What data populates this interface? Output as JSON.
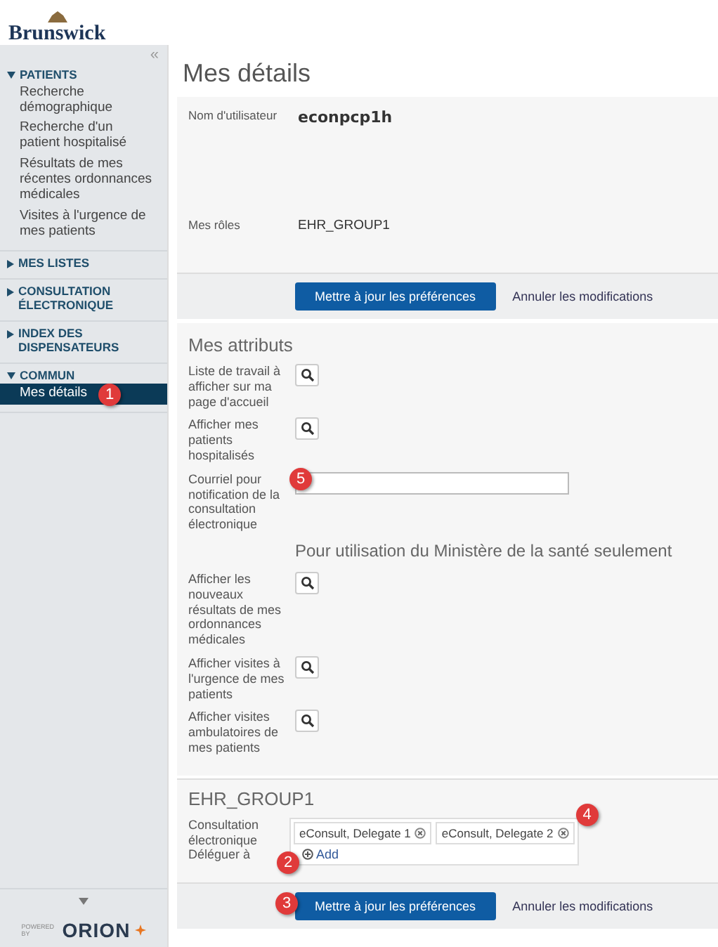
{
  "logo": {
    "name": "Brunswick"
  },
  "sidebar": {
    "collapse": "«",
    "sections": [
      {
        "label": "PATIENTS",
        "expanded": true,
        "items": [
          {
            "label": "Recherche démographique",
            "selected": false
          },
          {
            "label": "Recherche d'un patient hospitalisé",
            "selected": false
          },
          {
            "label": "Résultats de mes récentes ordonnances médicales",
            "selected": false
          },
          {
            "label": "Visites à l'urgence de mes patients",
            "selected": false
          }
        ]
      },
      {
        "label": "MES LISTES",
        "expanded": false
      },
      {
        "label": "CONSULTATION ÉLECTRONIQUE",
        "expanded": false
      },
      {
        "label": "INDEX DES DISPENSATEURS",
        "expanded": false
      },
      {
        "label": "COMMUN",
        "expanded": true,
        "items": [
          {
            "label": "Mes détails",
            "selected": true,
            "badge": "1"
          }
        ]
      }
    ],
    "footer": {
      "powered": "POWERED BY",
      "brand": "ORION"
    }
  },
  "title": "Mes détails",
  "user": {
    "fields": [
      {
        "label": "Nom d'utilisateur",
        "value": "econpcp1h",
        "bold": true
      },
      {
        "label": "Mes rôles",
        "value": "EHR_GROUP1",
        "bold": false
      }
    ]
  },
  "actions_top": {
    "primary": "Mettre à jour les préférences",
    "secondary": "Annuler les modifications"
  },
  "attributes": {
    "heading": "Mes attributs",
    "rows": [
      {
        "kind": "search",
        "label": "Liste de travail à afficher sur ma page d'accueil"
      },
      {
        "kind": "search",
        "label": "Afficher mes patients hospitalisés"
      },
      {
        "kind": "email",
        "label": "Courriel pour notification de la consultation électronique",
        "badge": "5"
      },
      {
        "kind": "heading",
        "label": "Pour utilisation du Ministère de la santé seulement"
      },
      {
        "kind": "search",
        "label": "Afficher les nouveaux résultats de mes ordonnances médicales"
      },
      {
        "kind": "search",
        "label": "Afficher visites à l'urgence de mes patients"
      },
      {
        "kind": "search",
        "label": "Afficher visites ambulatoires de mes patients"
      }
    ]
  },
  "group": {
    "heading": "EHR_GROUP1",
    "label": "Consultation électronique Déléguer à",
    "delegates": [
      "eConsult, Delegate 1",
      "eConsult, Delegate 2"
    ],
    "delegates_badge": "4",
    "add": "Add",
    "add_badge": "2"
  },
  "actions_bottom": {
    "primary": "Mettre à jour les préférences",
    "secondary": "Annuler les modifications",
    "badge": "3"
  }
}
